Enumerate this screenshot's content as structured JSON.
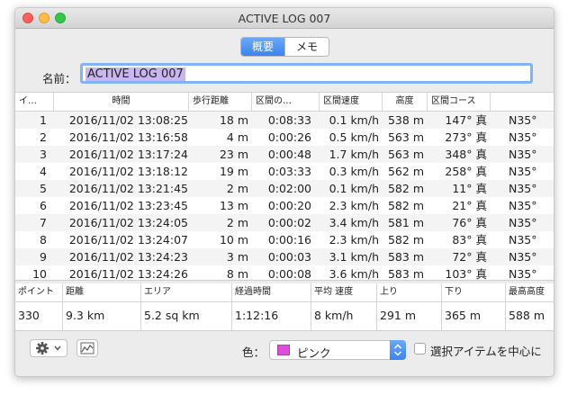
{
  "window": {
    "title": "ACTIVE LOG 007"
  },
  "segment": {
    "tabs": [
      "概要",
      "メモ"
    ],
    "selected": 0
  },
  "name_field": {
    "label": "名前：",
    "value": "ACTIVE LOG 007"
  },
  "table": {
    "headers": [
      "イ…",
      "時間",
      "歩行距離",
      "区間の…",
      "区間速度",
      "高度",
      "区間コース",
      ""
    ],
    "rows": [
      [
        "1",
        "2016/11/02 13:08:25",
        "18 m",
        "0:08:33",
        "0.1 km/h",
        "538 m",
        "147° 真",
        "N35°"
      ],
      [
        "2",
        "2016/11/02 13:16:58",
        "4 m",
        "0:00:26",
        "0.5 km/h",
        "563 m",
        "273° 真",
        "N35°"
      ],
      [
        "3",
        "2016/11/02 13:17:24",
        "23 m",
        "0:00:48",
        "1.7 km/h",
        "563 m",
        "348° 真",
        "N35°"
      ],
      [
        "4",
        "2016/11/02 13:18:12",
        "19 m",
        "0:03:33",
        "0.3 km/h",
        "562 m",
        "258° 真",
        "N35°"
      ],
      [
        "5",
        "2016/11/02 13:21:45",
        "2 m",
        "0:02:00",
        "0.1 km/h",
        "582 m",
        "11° 真",
        "N35°"
      ],
      [
        "6",
        "2016/11/02 13:23:45",
        "13 m",
        "0:00:20",
        "2.3 km/h",
        "582 m",
        "21° 真",
        "N35°"
      ],
      [
        "7",
        "2016/11/02 13:24:05",
        "2 m",
        "0:00:02",
        "3.4 km/h",
        "581 m",
        "76° 真",
        "N35°"
      ],
      [
        "8",
        "2016/11/02 13:24:07",
        "10 m",
        "0:00:16",
        "2.3 km/h",
        "582 m",
        "83° 真",
        "N35°"
      ],
      [
        "9",
        "2016/11/02 13:24:23",
        "3 m",
        "0:00:03",
        "3.1 km/h",
        "583 m",
        "72° 真",
        "N35°"
      ],
      [
        "10",
        "2016/11/02 13:24:26",
        "8 m",
        "0:00:08",
        "3.6 km/h",
        "583 m",
        "103° 真",
        "N35°"
      ]
    ]
  },
  "stats": {
    "headers": [
      "ポイント",
      "距離",
      "エリア",
      "経過時間",
      "平均 速度",
      "上り",
      "下り",
      "最高高度"
    ],
    "values": [
      "330",
      "9.3 km",
      "5.2 sq km",
      "1:12:16",
      "8 km/h",
      "291 m",
      "365 m",
      "588 m"
    ]
  },
  "footer": {
    "color_label": "色：",
    "color_value": "ピンク",
    "color_swatch": "#d94fd9",
    "center_label": "選択アイテムを中心に",
    "center_checked": false,
    "gear_icon": "gear-icon",
    "chart_icon": "line-chart-icon"
  },
  "accent_color": "#3b84ef"
}
